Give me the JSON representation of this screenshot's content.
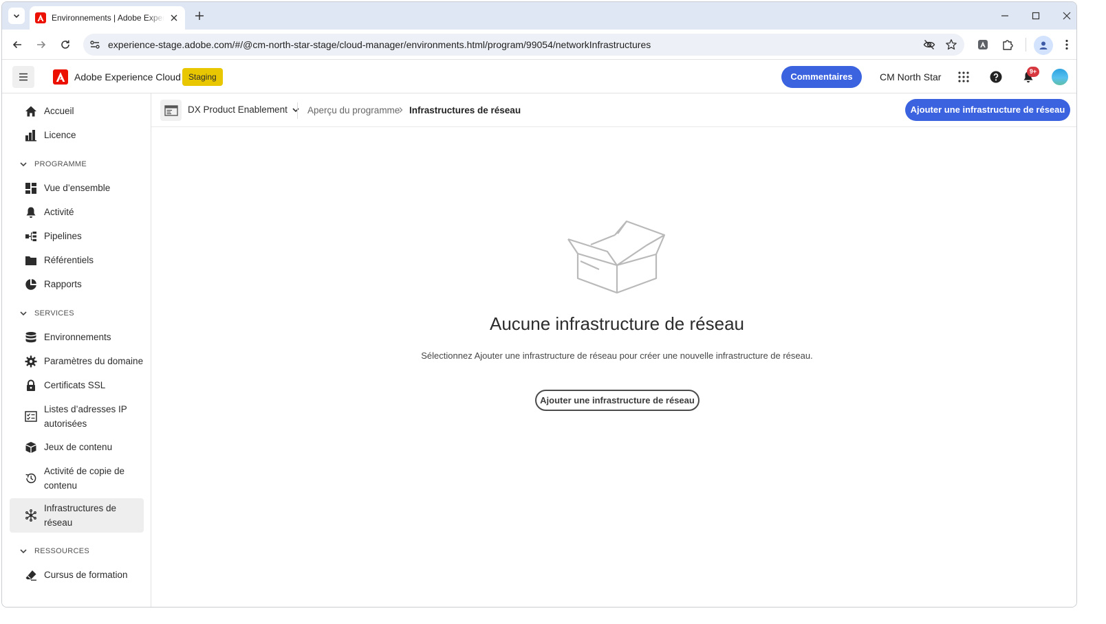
{
  "browser": {
    "tab_title": "Environnements | Adobe Experience Cloud",
    "url": "experience-stage.adobe.com/#/@cm-north-star-stage/cloud-manager/environments.html/program/99054/networkInfrastructures"
  },
  "header": {
    "app_name": "Adobe Experience Cloud",
    "env_badge": "Staging",
    "feedback_label": "Commentaires",
    "org_name": "CM North Star",
    "notification_count": "9+"
  },
  "sidebar": {
    "top_items": [
      {
        "label": "Accueil",
        "icon": "home-icon"
      },
      {
        "label": "Licence",
        "icon": "license-icon"
      }
    ],
    "sections": [
      {
        "title": "PROGRAMME",
        "items": [
          {
            "label": "Vue d’ensemble",
            "icon": "overview-icon"
          },
          {
            "label": "Activité",
            "icon": "bell-icon"
          },
          {
            "label": "Pipelines",
            "icon": "pipeline-icon"
          },
          {
            "label": "Référentiels",
            "icon": "folder-icon"
          },
          {
            "label": "Rapports",
            "icon": "reports-icon"
          }
        ]
      },
      {
        "title": "SERVICES",
        "items": [
          {
            "label": "Environnements",
            "icon": "database-icon"
          },
          {
            "label": "Paramètres du domaine",
            "icon": "gear-icon"
          },
          {
            "label": "Certificats SSL",
            "icon": "lock-icon"
          },
          {
            "label": "Listes d’adresses IP",
            "label2": "autorisées",
            "icon": "checklist-icon"
          },
          {
            "label": "Jeux de contenu",
            "icon": "box-icon"
          },
          {
            "label": "Activité de copie de",
            "label2": "contenu",
            "icon": "history-icon"
          },
          {
            "label": "Infrastructures de",
            "label2": "réseau",
            "icon": "network-icon",
            "active": true
          }
        ]
      },
      {
        "title": "RESSOURCES",
        "items": [
          {
            "label": "Cursus de formation",
            "icon": "eraser-icon"
          }
        ]
      }
    ]
  },
  "subheader": {
    "program_name": "DX Product Enablement",
    "breadcrumb_parent": "Aperçu du programme",
    "breadcrumb_current": "Infrastructures de réseau",
    "add_button": "Ajouter une infrastructure de réseau"
  },
  "empty_state": {
    "title": "Aucune infrastructure de réseau",
    "description": "Sélectionnez Ajouter une infrastructure de réseau pour créer une nouvelle infrastructure de réseau.",
    "button": "Ajouter une infrastructure de réseau"
  },
  "colors": {
    "primary": "#3b63e0",
    "staging": "#e8c600",
    "adobe_red": "#eb1000",
    "badge": "#d7373f"
  }
}
